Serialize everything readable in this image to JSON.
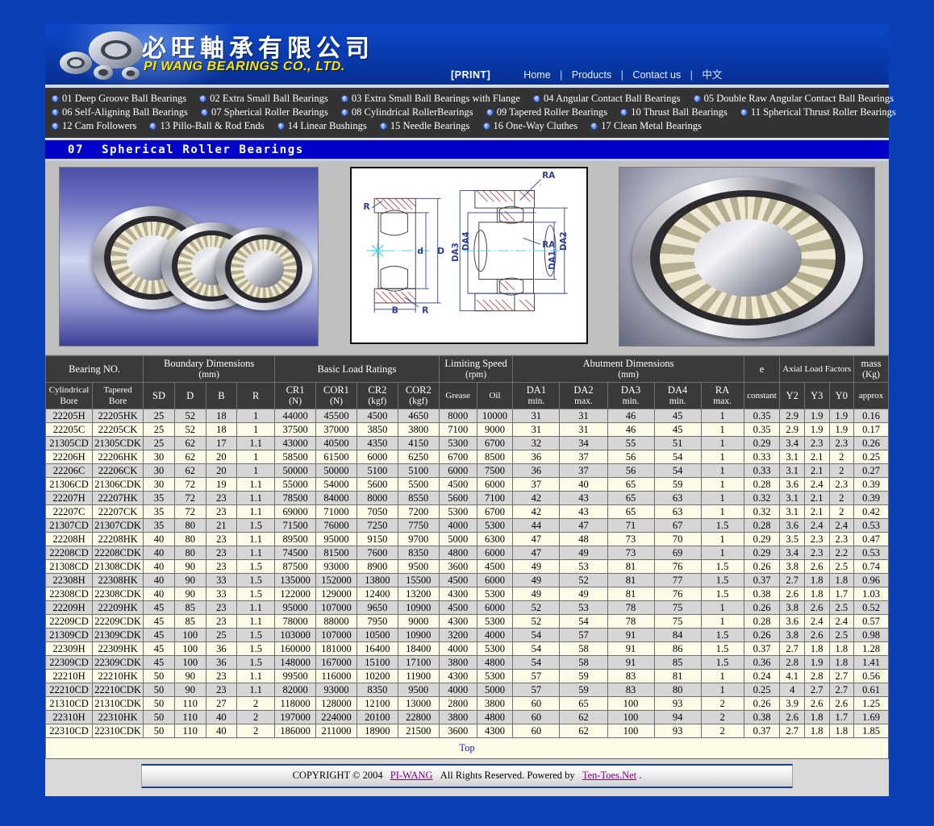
{
  "header": {
    "company_cn": "必旺軸承有限公司",
    "company_en": "PI WANG BEARINGS CO., LTD.",
    "print_label": "[PRINT]",
    "nav": [
      {
        "label": "Home"
      },
      {
        "label": "Products"
      },
      {
        "label": "Contact us"
      },
      {
        "label": "中文"
      }
    ],
    "nav_separator": "|"
  },
  "categories": [
    [
      "01 Deep Groove Ball Bearings",
      "02 Extra Small Ball Bearings",
      "03 Extra Small Ball Bearings with Flange",
      "04 Angular Contact Ball Bearings",
      "05 Double Raw Angular Contact Ball Bearings"
    ],
    [
      "06 Self-Aligning Ball Bearings",
      "07 Spherical Roller Bearings",
      "08 Cylindrical RollerBearings",
      "09 Tapered Roller Bearings",
      "10 Thrust Ball Bearings",
      "11 Spherical Thrust Roller Bearings"
    ],
    [
      "12 Cam Followers",
      "13 Pillo-Ball & Rod Ends",
      "14 Linear Bushings",
      "15 Needle Bearings",
      "16 One-Way Cluthes",
      "17 Clean Metal Bearings"
    ]
  ],
  "section": {
    "number": "07",
    "title": "Spherical Roller Bearings"
  },
  "diagram": {
    "labels": [
      "RA",
      "RA",
      "R",
      "R",
      "d",
      "D",
      "B",
      "DA1",
      "DA2",
      "DA3",
      "DA4"
    ]
  },
  "table": {
    "group_headers": [
      {
        "label": "Bearing NO.",
        "sub": ""
      },
      {
        "label": "Boundary Dimensions",
        "sub": "(mm)"
      },
      {
        "label": "Basic Load Ratings",
        "sub": ""
      },
      {
        "label": "Limiting Speed",
        "sub": "(rpm)"
      },
      {
        "label": "Abutment Dimensions",
        "sub": "(mm)"
      },
      {
        "label": "e",
        "sub": ""
      },
      {
        "label": "Axial Load Factors",
        "sub": ""
      },
      {
        "label": "mass",
        "sub": "(Kg)"
      }
    ],
    "columns": [
      {
        "label": "Cylindrical",
        "sub": "Bore"
      },
      {
        "label": "Tapered",
        "sub": "Bore"
      },
      {
        "label": "SD",
        "sub": ""
      },
      {
        "label": "D",
        "sub": ""
      },
      {
        "label": "B",
        "sub": ""
      },
      {
        "label": "R",
        "sub": ""
      },
      {
        "label": "CR1",
        "sub": "(N)"
      },
      {
        "label": "COR1",
        "sub": "(N)"
      },
      {
        "label": "CR2",
        "sub": "(kgf)"
      },
      {
        "label": "COR2",
        "sub": "(kgf)"
      },
      {
        "label": "Grease",
        "sub": ""
      },
      {
        "label": "Oil",
        "sub": ""
      },
      {
        "label": "DA1",
        "sub": "min."
      },
      {
        "label": "DA2",
        "sub": "max."
      },
      {
        "label": "DA3",
        "sub": "min."
      },
      {
        "label": "DA4",
        "sub": "min."
      },
      {
        "label": "RA",
        "sub": "max."
      },
      {
        "label": "constant",
        "sub": ""
      },
      {
        "label": "Y2",
        "sub": ""
      },
      {
        "label": "Y3",
        "sub": ""
      },
      {
        "label": "Y0",
        "sub": ""
      },
      {
        "label": "approx",
        "sub": ""
      }
    ],
    "rows": [
      [
        "22205H",
        "22205HK",
        "25",
        "52",
        "18",
        "1",
        "44000",
        "45500",
        "4500",
        "4650",
        "8000",
        "10000",
        "31",
        "31",
        "46",
        "45",
        "1",
        "0.35",
        "2.9",
        "1.9",
        "1.9",
        "0.16"
      ],
      [
        "22205C",
        "22205CK",
        "25",
        "52",
        "18",
        "1",
        "37500",
        "37000",
        "3850",
        "3800",
        "7100",
        "9000",
        "31",
        "31",
        "46",
        "45",
        "1",
        "0.35",
        "2.9",
        "1.9",
        "1.9",
        "0.17"
      ],
      [
        "21305CD",
        "21305CDK",
        "25",
        "62",
        "17",
        "1.1",
        "43000",
        "40500",
        "4350",
        "4150",
        "5300",
        "6700",
        "32",
        "34",
        "55",
        "51",
        "1",
        "0.29",
        "3.4",
        "2.3",
        "2.3",
        "0.26"
      ],
      [
        "22206H",
        "22206HK",
        "30",
        "62",
        "20",
        "1",
        "58500",
        "61500",
        "6000",
        "6250",
        "6700",
        "8500",
        "36",
        "37",
        "56",
        "54",
        "1",
        "0.33",
        "3.1",
        "2.1",
        "2",
        "0.25"
      ],
      [
        "22206C",
        "22206CK",
        "30",
        "62",
        "20",
        "1",
        "50000",
        "50000",
        "5100",
        "5100",
        "6000",
        "7500",
        "36",
        "37",
        "56",
        "54",
        "1",
        "0.33",
        "3.1",
        "2.1",
        "2",
        "0.27"
      ],
      [
        "21306CD",
        "21306CDK",
        "30",
        "72",
        "19",
        "1.1",
        "55000",
        "54000",
        "5600",
        "5500",
        "4500",
        "6000",
        "37",
        "40",
        "65",
        "59",
        "1",
        "0.28",
        "3.6",
        "2.4",
        "2.3",
        "0.39"
      ],
      [
        "22207H",
        "22207HK",
        "35",
        "72",
        "23",
        "1.1",
        "78500",
        "84000",
        "8000",
        "8550",
        "5600",
        "7100",
        "42",
        "43",
        "65",
        "63",
        "1",
        "0.32",
        "3.1",
        "2.1",
        "2",
        "0.39"
      ],
      [
        "22207C",
        "22207CK",
        "35",
        "72",
        "23",
        "1.1",
        "69000",
        "71000",
        "7050",
        "7200",
        "5300",
        "6700",
        "42",
        "43",
        "65",
        "63",
        "1",
        "0.32",
        "3.1",
        "2.1",
        "2",
        "0.42"
      ],
      [
        "21307CD",
        "21307CDK",
        "35",
        "80",
        "21",
        "1.5",
        "71500",
        "76000",
        "7250",
        "7750",
        "4000",
        "5300",
        "44",
        "47",
        "71",
        "67",
        "1.5",
        "0.28",
        "3.6",
        "2.4",
        "2.4",
        "0.53"
      ],
      [
        "22208H",
        "22208HK",
        "40",
        "80",
        "23",
        "1.1",
        "89500",
        "95000",
        "9150",
        "9700",
        "5000",
        "6300",
        "47",
        "48",
        "73",
        "70",
        "1",
        "0.29",
        "3.5",
        "2.3",
        "2.3",
        "0.47"
      ],
      [
        "22208CD",
        "22208CDK",
        "40",
        "80",
        "23",
        "1.1",
        "74500",
        "81500",
        "7600",
        "8350",
        "4800",
        "6000",
        "47",
        "49",
        "73",
        "69",
        "1",
        "0.29",
        "3.4",
        "2.3",
        "2.2",
        "0.53"
      ],
      [
        "21308CD",
        "21308CDK",
        "40",
        "90",
        "23",
        "1.5",
        "87500",
        "93000",
        "8900",
        "9500",
        "3600",
        "4500",
        "49",
        "53",
        "81",
        "76",
        "1.5",
        "0.26",
        "3.8",
        "2.6",
        "2.5",
        "0.74"
      ],
      [
        "22308H",
        "22308HK",
        "40",
        "90",
        "33",
        "1.5",
        "135000",
        "152000",
        "13800",
        "15500",
        "4500",
        "6000",
        "49",
        "52",
        "81",
        "77",
        "1.5",
        "0.37",
        "2.7",
        "1.8",
        "1.8",
        "0.96"
      ],
      [
        "22308CD",
        "22308CDK",
        "40",
        "90",
        "33",
        "1.5",
        "122000",
        "129000",
        "12400",
        "13200",
        "4300",
        "5300",
        "49",
        "49",
        "81",
        "76",
        "1.5",
        "0.38",
        "2.6",
        "1.8",
        "1.7",
        "1.03"
      ],
      [
        "22209H",
        "22209HK",
        "45",
        "85",
        "23",
        "1.1",
        "95000",
        "107000",
        "9650",
        "10900",
        "4500",
        "6000",
        "52",
        "53",
        "78",
        "75",
        "1",
        "0.26",
        "3.8",
        "2.6",
        "2.5",
        "0.52"
      ],
      [
        "22209CD",
        "22209CDK",
        "45",
        "85",
        "23",
        "1.1",
        "78000",
        "88000",
        "7950",
        "9000",
        "4300",
        "5300",
        "52",
        "54",
        "78",
        "75",
        "1",
        "0.28",
        "3.6",
        "2.4",
        "2.4",
        "0.57"
      ],
      [
        "21309CD",
        "21309CDK",
        "45",
        "100",
        "25",
        "1.5",
        "103000",
        "107000",
        "10500",
        "10900",
        "3200",
        "4000",
        "54",
        "57",
        "91",
        "84",
        "1.5",
        "0.26",
        "3.8",
        "2.6",
        "2.5",
        "0.98"
      ],
      [
        "22309H",
        "22309HK",
        "45",
        "100",
        "36",
        "1.5",
        "160000",
        "181000",
        "16400",
        "18400",
        "4000",
        "5300",
        "54",
        "58",
        "91",
        "86",
        "1.5",
        "0.37",
        "2.7",
        "1.8",
        "1.8",
        "1.28"
      ],
      [
        "22309CD",
        "22309CDK",
        "45",
        "100",
        "36",
        "1.5",
        "148000",
        "167000",
        "15100",
        "17100",
        "3800",
        "4800",
        "54",
        "58",
        "91",
        "85",
        "1.5",
        "0.36",
        "2.8",
        "1.9",
        "1.8",
        "1.41"
      ],
      [
        "22210H",
        "22210HK",
        "50",
        "90",
        "23",
        "1.1",
        "99500",
        "116000",
        "10200",
        "11900",
        "4300",
        "5300",
        "57",
        "59",
        "83",
        "81",
        "1",
        "0.24",
        "4.1",
        "2.8",
        "2.7",
        "0.56"
      ],
      [
        "22210CD",
        "22210CDK",
        "50",
        "90",
        "23",
        "1.1",
        "82000",
        "93000",
        "8350",
        "9500",
        "4000",
        "5000",
        "57",
        "59",
        "83",
        "80",
        "1",
        "0.25",
        "4",
        "2.7",
        "2.7",
        "0.61"
      ],
      [
        "21310CD",
        "21310CDK",
        "50",
        "110",
        "27",
        "2",
        "118000",
        "128000",
        "12100",
        "13000",
        "2800",
        "3800",
        "60",
        "65",
        "100",
        "93",
        "2",
        "0.26",
        "3.9",
        "2.6",
        "2.6",
        "1.25"
      ],
      [
        "22310H",
        "22310HK",
        "50",
        "110",
        "40",
        "2",
        "197000",
        "224000",
        "20100",
        "22800",
        "3800",
        "4800",
        "60",
        "62",
        "100",
        "94",
        "2",
        "0.38",
        "2.6",
        "1.8",
        "1.7",
        "1.69"
      ],
      [
        "22310CD",
        "22310CDK",
        "50",
        "110",
        "40",
        "2",
        "186000",
        "211000",
        "18900",
        "21500",
        "3600",
        "4300",
        "60",
        "62",
        "100",
        "93",
        "2",
        "0.37",
        "2.7",
        "1.8",
        "1.8",
        "1.85"
      ]
    ]
  },
  "footer": {
    "top_link": "Top",
    "copyright_prefix": "COPYRIGHT © 2004",
    "company_link": "PI-WANG",
    "rights": "All Rights Reserved. Powered by",
    "powered_link": "Ten-Toes.Net",
    "period": "."
  },
  "colors": {
    "page_blue": "#0a3fb5",
    "banner_blue": "#0a3cb0",
    "section_blue": "#0000c8",
    "nav_dark": "#333333",
    "row_odd": "#d6d6d6",
    "row_even": "#fbfbe8",
    "header_cell": "#3a3a3a",
    "yellow_text": "#ffe400",
    "link_purple": "#800080"
  }
}
